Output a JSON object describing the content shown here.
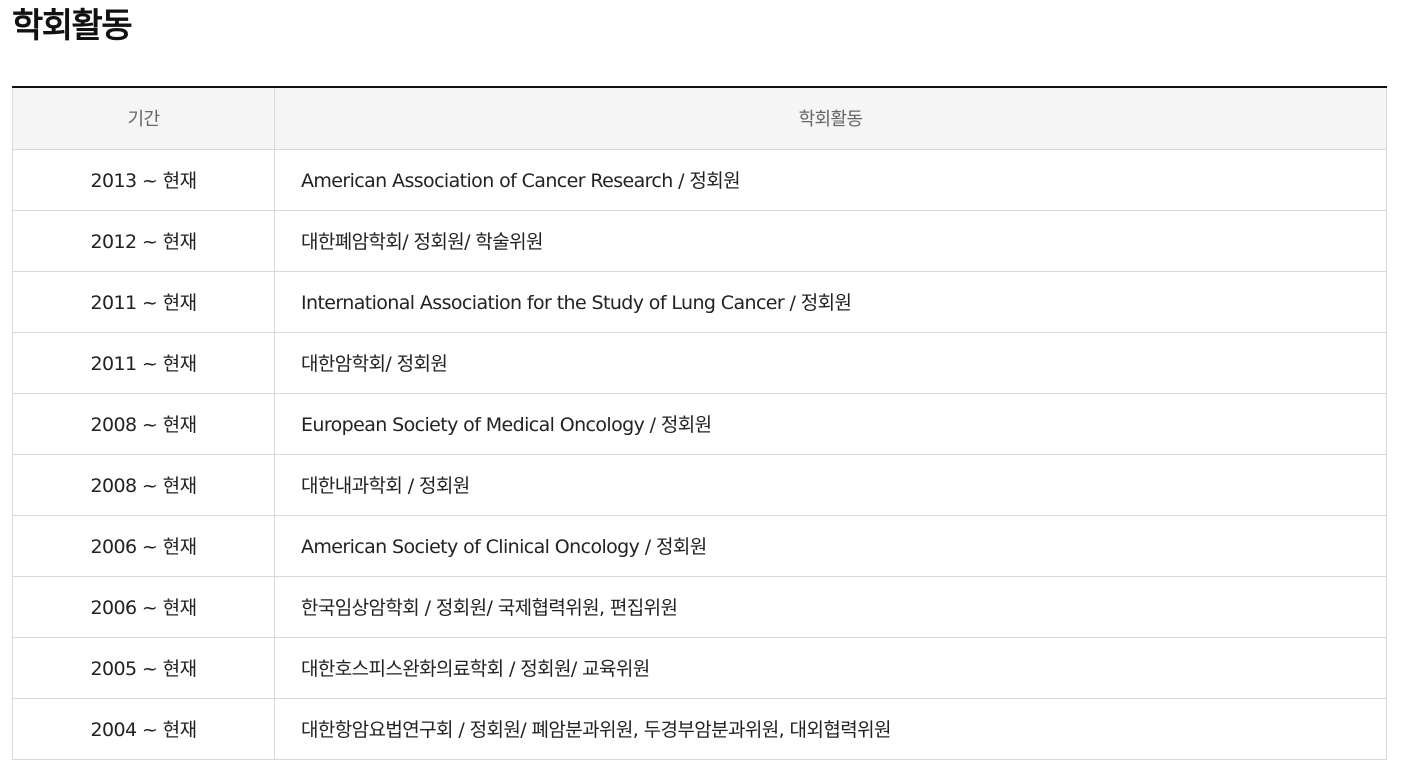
{
  "page": {
    "title": "학회활동"
  },
  "table": {
    "headers": {
      "period": "기간",
      "activity": "학회활동"
    },
    "rows": [
      {
        "period": "2013 ~ 현재",
        "activity": "American Association of Cancer Research / 정회원"
      },
      {
        "period": "2012 ~ 현재",
        "activity": "대한폐암학회/ 정회원/ 학술위원"
      },
      {
        "period": "2011 ~ 현재",
        "activity": "International Association for the Study of Lung Cancer / 정회원"
      },
      {
        "period": "2011 ~ 현재",
        "activity": "대한암학회/ 정회원"
      },
      {
        "period": "2008 ~ 현재",
        "activity": "European Society of Medical Oncology / 정회원"
      },
      {
        "period": "2008 ~ 현재",
        "activity": "대한내과학회 / 정회원"
      },
      {
        "period": "2006 ~ 현재",
        "activity": "American Society of Clinical Oncology / 정회원"
      },
      {
        "period": "2006 ~ 현재",
        "activity": "한국임상암학회 / 정회원/ 국제협력위원, 편집위원"
      },
      {
        "period": "2005 ~ 현재",
        "activity": "대한호스피스완화의료학회 / 정회원/ 교육위원"
      },
      {
        "period": "2004 ~ 현재",
        "activity": "대한항암요법연구회 / 정회원/ 폐암분과위원, 두경부암분과위원, 대외협력위원"
      }
    ]
  },
  "colors": {
    "header_bg": "#f5f5f5",
    "top_border": "#111111",
    "grid_line": "#d9d9d9"
  }
}
